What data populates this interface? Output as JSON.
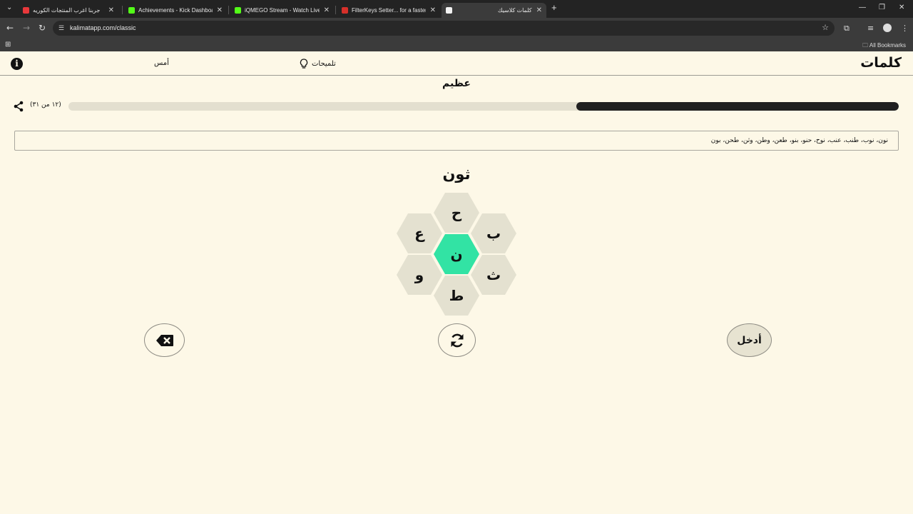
{
  "browser": {
    "tabs": [
      {
        "title": "جربنا اغرب المنتجات الكوريه",
        "color": "#e8383b",
        "active": false
      },
      {
        "title": "Achievements - Kick Dashboard",
        "color": "#53fc18",
        "active": false
      },
      {
        "title": "iQMEGO Stream - Watch Live o",
        "color": "#53fc18",
        "active": false
      },
      {
        "title": "FilterKeys Setter... for a faster k",
        "color": "#d6302a",
        "active": false
      },
      {
        "title": "كلمات كلاسيك",
        "color": "#f2f2f2",
        "active": true
      }
    ],
    "url": "kalimatapp.com/classic",
    "bookmarks_label": "All Bookmarks"
  },
  "app": {
    "logo": "كلمات",
    "hints_label": "تلميحات",
    "yesterday_label": "أمس",
    "rank": "عظيم",
    "count_text": "(١٢ من ٣١)",
    "progress": 0.388,
    "found_words": "نون، نوب، طنب، عنب، نوح، حنو، بنو، طعن، وطن، وثن، طحن، بون",
    "current_word": "ثون",
    "letters": {
      "center": "ن",
      "top": "ح",
      "top_right": "ب",
      "bottom_right": "ث",
      "bottom": "ط",
      "bottom_left": "و",
      "top_left": "ع"
    },
    "enter_label": "أدخل"
  }
}
